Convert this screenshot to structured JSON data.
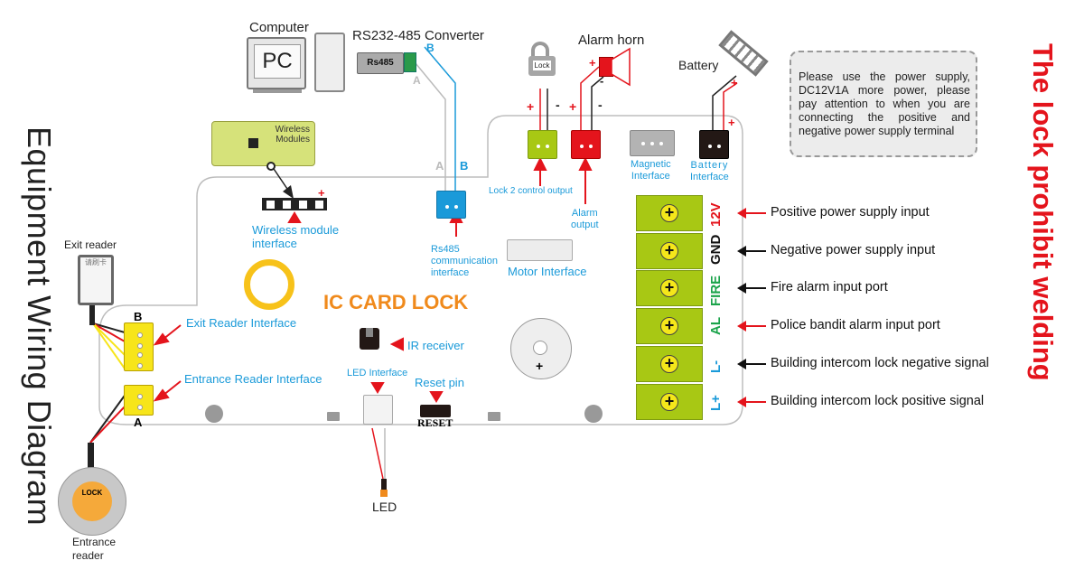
{
  "titles": {
    "left_vertical": "Equipment  Wiring Diagram",
    "right_vertical": "The lock prohibit welding",
    "board_title": "IC CARD  LOCK"
  },
  "devices": {
    "computer": "Computer",
    "pc_screen": "PC",
    "converter": "RS232-485 Converter",
    "converter_badge": "Rs485",
    "converter_a": "A",
    "converter_b": "B",
    "lock": "Lock",
    "alarm_horn": "Alarm horn",
    "battery": "Battery",
    "wireless_modules_line1": "Wireless",
    "wireless_modules_line2": "Modules",
    "exit_reader": "Exit reader",
    "exit_reader_cn": "请刷卡",
    "entrance_reader_line1": "Entrance",
    "entrance_reader_line2": "reader",
    "entrance_lock_badge": "LOCK",
    "led": "LED"
  },
  "note": "Please use the power supply, DC12V1A more power, please pay attention to when you are connecting the positive and negative power supply terminal",
  "interfaces": {
    "lock2_output": "Lock 2 control output",
    "alarm_output_line1": "Alarm",
    "alarm_output_line2": "output",
    "magnetic_line1": "Magnetic",
    "magnetic_line2": "Interface",
    "battery_line1": "Battery",
    "battery_line2": "Interface",
    "wireless_line1": "Wireless module",
    "wireless_line2": "interface",
    "rs485_line1": "Rs485",
    "rs485_line2": "communication",
    "rs485_line3": "interface",
    "rs485_a": "A",
    "rs485_b": "B",
    "motor": "Motor Interface",
    "exit_reader_interface": "Exit Reader Interface",
    "entrance_reader_interface": "Entrance Reader Interface",
    "port_b": "B",
    "port_a": "A",
    "ir_receiver": "IR receiver",
    "led_interface": "LED Interface",
    "reset_pin": "Reset pin",
    "reset_label": "RESET"
  },
  "polarity": {
    "plus": "+",
    "minus": "-"
  },
  "terminals": [
    {
      "code": "12V",
      "code_color": "#e4141c",
      "arrow_color": "#e4141c",
      "desc": "Positive power supply input"
    },
    {
      "code": "GND",
      "code_color": "#111111",
      "arrow_color": "#111111",
      "desc": "Negative power supply input"
    },
    {
      "code": "FIRE",
      "code_color": "#1aa34a",
      "arrow_color": "#111111",
      "desc": "Fire alarm input port"
    },
    {
      "code": "AL",
      "code_color": "#1aa34a",
      "arrow_color": "#e4141c",
      "desc": "Police bandit alarm input port"
    },
    {
      "code": "L-",
      "code_color": "#1a9ad9",
      "arrow_color": "#111111",
      "desc": "Building intercom  lock negative signal"
    },
    {
      "code": "L+",
      "code_color": "#1a9ad9",
      "arrow_color": "#e4141c",
      "desc": "Building intercom  lock positive signal"
    }
  ],
  "colors": {
    "accent_red": "#e4141c",
    "label_blue": "#1a9ad9",
    "title_orange": "#f08a1c",
    "terminal_green": "#a8c814",
    "reader_yellow": "#f7e51a"
  }
}
